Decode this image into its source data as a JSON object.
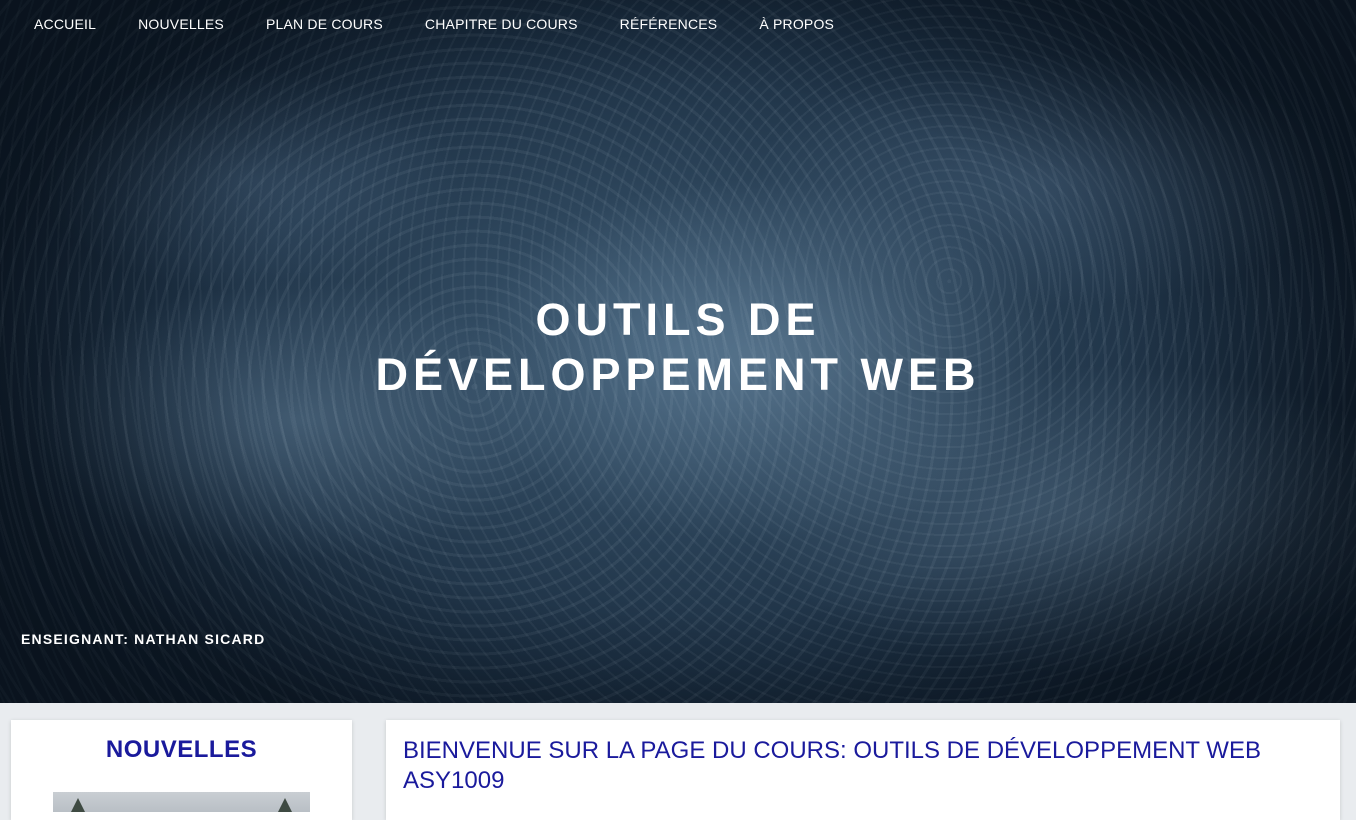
{
  "nav": {
    "items": [
      {
        "label": "ACCUEIL"
      },
      {
        "label": "NOUVELLES"
      },
      {
        "label": "PLAN DE COURS"
      },
      {
        "label": "CHAPITRE DU COURS"
      },
      {
        "label": "RÉFÉRENCES"
      },
      {
        "label": "À PROPOS"
      }
    ]
  },
  "hero": {
    "title_line1": "OUTILS DE",
    "title_line2": "DÉVELOPPEMENT WEB",
    "teacher": "ENSEIGNANT: NATHAN SICARD"
  },
  "news": {
    "heading": "NOUVELLES"
  },
  "welcome": {
    "heading_line1": "BIENVENUE SUR LA PAGE DU COURS: OUTILS DE DÉVELOPPEMENT WEB",
    "heading_line2": "ASY1009"
  },
  "colors": {
    "heading": "#1a1a9c",
    "nav_text": "#ffffff"
  }
}
